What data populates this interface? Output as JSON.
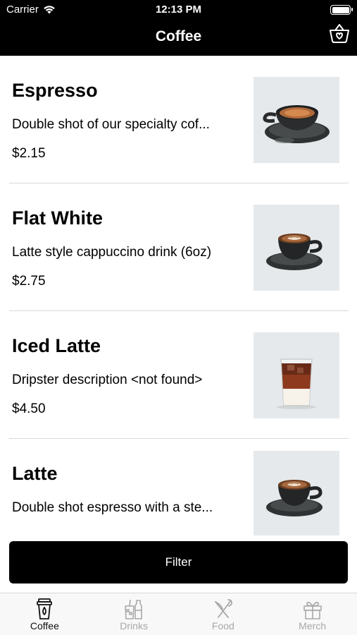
{
  "status_bar": {
    "carrier": "Carrier",
    "time": "12:13 PM"
  },
  "header": {
    "title": "Coffee",
    "basket_icon": "basket-icon"
  },
  "items": [
    {
      "name": "Espresso",
      "description": "Double shot of our specialty cof...",
      "price": "$2.15",
      "image": "espresso-cup"
    },
    {
      "name": "Flat White",
      "description": "Latte style cappuccino drink (6oz)",
      "price": "$2.75",
      "image": "latte-art-cup"
    },
    {
      "name": "Iced Latte",
      "description": "Dripster description <not found>",
      "price": "$4.50",
      "image": "iced-latte-glass"
    },
    {
      "name": "Latte",
      "description": "Double shot espresso with a ste...",
      "price": "",
      "image": "latte-art-cup"
    }
  ],
  "filter_button": {
    "label": "Filter"
  },
  "tabs": [
    {
      "label": "Coffee",
      "icon": "coffee-cup-icon",
      "active": true
    },
    {
      "label": "Drinks",
      "icon": "drinks-icon",
      "active": false
    },
    {
      "label": "Food",
      "icon": "fork-knife-icon",
      "active": false
    },
    {
      "label": "Merch",
      "icon": "gift-icon",
      "active": false
    }
  ],
  "colors": {
    "header_bg": "#000000",
    "active_tab": "#111111",
    "inactive_tab": "#a8a8a8",
    "divider": "#d9d9d9"
  }
}
